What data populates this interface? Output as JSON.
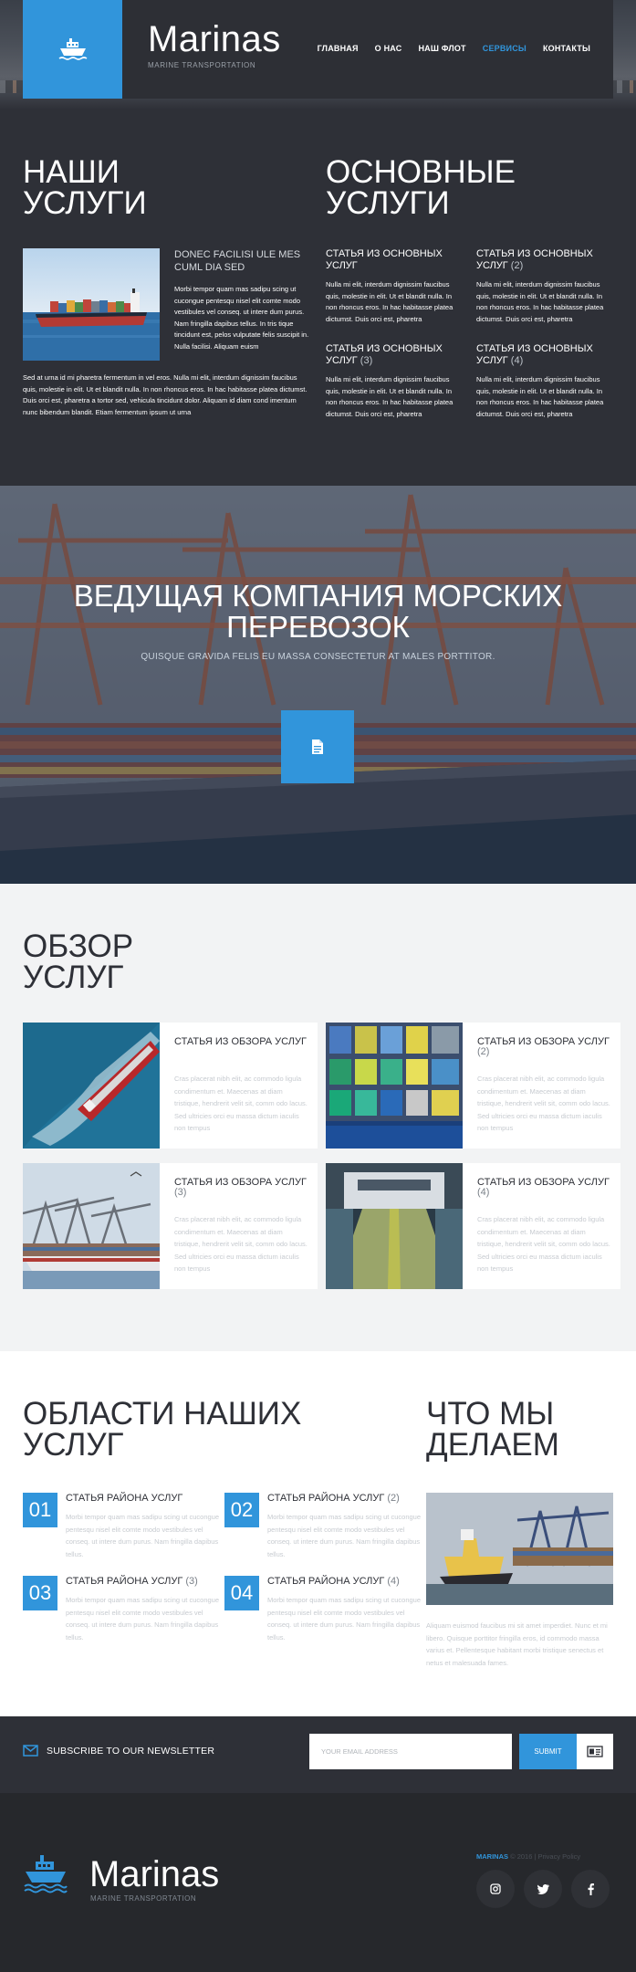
{
  "colors": {
    "accent": "#3195db",
    "dark": "#2e3037",
    "footer": "#26282c",
    "light": "#f2f3f4"
  },
  "header": {
    "brand": "Marinas",
    "tagline": "MARINE TRANSPORTATION",
    "nav": [
      {
        "label": "ГЛАВНАЯ",
        "active": false
      },
      {
        "label": "О НАС",
        "active": false
      },
      {
        "label": "НАШ ФЛОТ",
        "active": false
      },
      {
        "label": "СЕРВИСЫ",
        "active": true
      },
      {
        "label": "КОНТАКТЫ",
        "active": false
      }
    ]
  },
  "our_services": {
    "title_line1": "НАШИ",
    "title_line2": "УСЛУГИ",
    "subtitle": "DONEC FACILISI ULE MES CUML DIA SED",
    "desc": "Morbi tempor quam mas sadipu scing ut cucongue pentesqu nisel elit comte modo vestibules vel conseq. ut intere dum purus. Nam fringilla dapibus tellus. In tris tique tincidunt est, pelos vulputate felis suscipit in. Nulla facilisi. Aliquam euism",
    "full_text": "Sed at urna id mi pharetra fermentum in vel eros. Nulla mi elit, interdum dignissim faucibus quis, molestie in elit. Ut et blandit nulla. In non rhoncus eros. In hac habitasse platea dictumst. Duis orci est, pharetra a tortor sed, vehicula tincidunt dolor. Aliquam id diam cond imentum nunc bibendum blandit. Etiam fermentum ipsum ut urna"
  },
  "main_services": {
    "title_line1": "ОСНОВНЫЕ",
    "title_line2": "УСЛУГИ",
    "articles": [
      {
        "title": "СТАТЬЯ ИЗ ОСНОВНЫХ УСЛУГ",
        "num": "",
        "body": "Nulla mi elit, interdum dignissim faucibus quis, molestie in elit. Ut et blandit nulla. In non rhoncus eros. In hac habitasse platea dictumst. Duis orci est, pharetra"
      },
      {
        "title": "СТАТЬЯ ИЗ ОСНОВНЫХ УСЛУГ",
        "num": "(2)",
        "body": "Nulla mi elit, interdum dignissim faucibus quis, molestie in elit. Ut et blandit nulla. In non rhoncus eros. In hac habitasse platea dictumst. Duis orci est, pharetra"
      },
      {
        "title": "СТАТЬЯ ИЗ ОСНОВНЫХ УСЛУГ",
        "num": "(3)",
        "body": "Nulla mi elit, interdum dignissim faucibus quis, molestie in elit. Ut et blandit nulla. In non rhoncus eros. In hac habitasse platea dictumst. Duis orci est, pharetra"
      },
      {
        "title": "СТАТЬЯ ИЗ ОСНОВНЫХ УСЛУГ",
        "num": "(4)",
        "body": "Nulla mi elit, interdum dignissim faucibus quis, molestie in elit. Ut et blandit nulla. In non rhoncus eros. In hac habitasse platea dictumst. Duis orci est, pharetra"
      }
    ]
  },
  "banner": {
    "title_line1": "ВЕДУЩАЯ КОМПАНИЯ МОРСКИХ",
    "title_line2": "ПЕРЕВОЗОК",
    "subtitle": "QUISQUE GRAVIDA FELIS EU MASSA CONSECTETUR AT MALES PORTTITOR.",
    "button_icon": "document-icon"
  },
  "overview": {
    "title_line1": "ОБЗОР",
    "title_line2": "УСЛУГ",
    "cards": [
      {
        "title": "СТАТЬЯ ИЗ ОБЗОРА УСЛУГ",
        "num": "",
        "body": "Cras placerat nibh elit, ac commodo ligula condimentum et. Maecenas at diam tristique, hendrerit velit sit, comm odo lacus. Sed ultricies orci eu massa dictum iaculis non tempus"
      },
      {
        "title": "СТАТЬЯ ИЗ ОБЗОРА УСЛУГ",
        "num": "(2)",
        "body": "Cras placerat nibh elit, ac commodo ligula condimentum et. Maecenas at diam tristique, hendrerit velit sit, comm odo lacus. Sed ultricies orci eu massa dictum iaculis non tempus"
      },
      {
        "title": "СТАТЬЯ ИЗ ОБЗОРА УСЛУГ",
        "num": "(3)",
        "body": "Cras placerat nibh elit, ac commodo ligula condimentum et. Maecenas at diam tristique, hendrerit velit sit, comm odo lacus. Sed ultricies orci eu massa dictum iaculis non tempus"
      },
      {
        "title": "СТАТЬЯ ИЗ ОБЗОРА УСЛУГ",
        "num": "(4)",
        "body": "Cras placerat nibh elit, ac commodo ligula condimentum et. Maecenas at diam tristique, hendrerit velit sit, comm odo lacus. Sed ultricies orci eu massa dictum iaculis non tempus"
      }
    ]
  },
  "areas": {
    "title_line1": "ОБЛАСТИ НАШИХ",
    "title_line2": "УСЛУГ",
    "items": [
      {
        "num": "01",
        "title": "СТАТЬЯ РАЙОНА УСЛУГ",
        "suffix": "",
        "body": "Morbi tempor quam mas sadipu scing ut cucongue pentesqu nisel elit comte modo vestibules vel conseq. ut intere dum purus. Nam fringilla dapibus tellus."
      },
      {
        "num": "02",
        "title": "СТАТЬЯ РАЙОНА УСЛУГ",
        "suffix": "(2)",
        "body": "Morbi tempor quam mas sadipu scing ut cucongue pentesqu nisel elit comte modo vestibules vel conseq. ut intere dum purus. Nam fringilla dapibus tellus."
      },
      {
        "num": "03",
        "title": "СТАТЬЯ РАЙОНА УСЛУГ",
        "suffix": "(3)",
        "body": "Morbi tempor quam mas sadipu scing ut cucongue pentesqu nisel elit comte modo vestibules vel conseq. ut intere dum purus. Nam fringilla dapibus tellus."
      },
      {
        "num": "04",
        "title": "СТАТЬЯ РАЙОНА УСЛУГ",
        "suffix": "(4)",
        "body": "Morbi tempor quam mas sadipu scing ut cucongue pentesqu nisel elit comte modo vestibules vel conseq. ut intere dum purus. Nam fringilla dapibus tellus."
      }
    ]
  },
  "what_we_do": {
    "title_line1": "ЧТО МЫ",
    "title_line2": "ДЕЛАЕМ",
    "body": "Aliquam euismod faucibus mi sit amet imperdiet. Nunc et mi libero. Quisque porttitor fringilla eros, id commodo massa varius et. Pellentesque habitant morbi tristique senectus et netus et malesuada fames."
  },
  "newsletter": {
    "label": "SUBSCRIBE TO OUR NEWSLETTER",
    "placeholder": "YOUR EMAIL ADDRESS",
    "button": "SUBMIT"
  },
  "footer": {
    "brand": "Marinas",
    "tagline": "MARINE TRANSPORTATION",
    "copy_brand": "MARINAS",
    "copy_rest": " © 2016 | Privacy Policy",
    "social": [
      "instagram-icon",
      "twitter-icon",
      "facebook-icon"
    ]
  }
}
